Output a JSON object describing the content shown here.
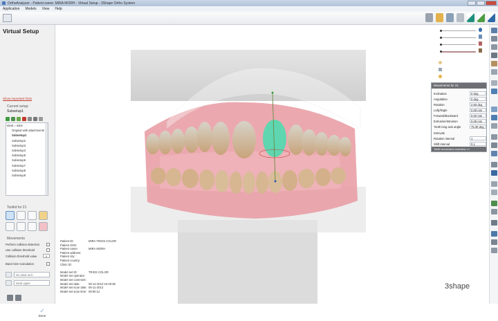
{
  "window": {
    "title": "OrthoAnalyzer - Patient name: MIRA MORH - Virtual Setup - 3Shape Ortho System"
  },
  "menu": [
    "Application",
    "Models",
    "View",
    "Help"
  ],
  "sidebar": {
    "title": "Virtual Setup",
    "important_link": "Show important hints",
    "current_setup_label": "Current setup:",
    "current_setup_value": "Subsetup1",
    "tree": [
      {
        "label": "Ideal = subs",
        "level": "root"
      },
      {
        "label": "Original with attachments",
        "level": "child"
      },
      {
        "label": "Subsetup1",
        "level": "child",
        "selected": true
      },
      {
        "label": "Subsetup2",
        "level": "child"
      },
      {
        "label": "Subsetup3",
        "level": "child"
      },
      {
        "label": "Subsetup4",
        "level": "child"
      },
      {
        "label": "Subsetup5",
        "level": "child"
      },
      {
        "label": "Subsetup6",
        "level": "child"
      },
      {
        "label": "Subsetup7",
        "level": "child"
      },
      {
        "label": "Subsetup8",
        "level": "child"
      },
      {
        "label": "Subsetup9",
        "level": "child"
      }
    ],
    "toolkit_label": "Toolkit for 21",
    "movements_label": "Movements",
    "movements": {
      "collision_detection": "Perform collision detection",
      "collision_threshold": "Use collision threshold",
      "collision_threshold_value_label": "Collision threshold value",
      "collision_threshold_value": "0",
      "band_size": "Band Size Calculation"
    },
    "dropdown_1": "No ideal arch",
    "dropdown_2": "Ideal upper",
    "done_label": "Done"
  },
  "patient_info": [
    {
      "k": "Patient ID:",
      "v": "MIRA TRIOS COLOR"
    },
    {
      "k": "Patient SSN:",
      "v": ""
    },
    {
      "k": "Patient name:",
      "v": "MIRA MORH"
    },
    {
      "k": "Patient address:",
      "v": ""
    },
    {
      "k": "Patient city:",
      "v": ""
    },
    {
      "k": "Patient country:",
      "v": ""
    },
    {
      "k": "Clinic ID:",
      "v": ""
    },
    {
      "k": "",
      "v": ""
    },
    {
      "k": "Model set ID:",
      "v": "TRIOS COLOR"
    },
    {
      "k": "Model set operator:",
      "v": ""
    },
    {
      "k": "Model set comment:",
      "v": ""
    },
    {
      "k": "Model set date:",
      "v": "06-12-2013 10:20:05"
    },
    {
      "k": "Model set scan date:",
      "v": "05-11-2013"
    },
    {
      "k": "Model set scan time:",
      "v": "09:00:12"
    }
  ],
  "brand": "3shape",
  "movements_panel": {
    "title": "Movements for 21",
    "rows": [
      {
        "label": "Inclination",
        "value": "0 deg"
      },
      {
        "label": "Angulation",
        "value": "0 deg"
      },
      {
        "label": "Rotation",
        "value": "2.93 deg"
      },
      {
        "label": "Lully/lingle",
        "value": "0.09 mm"
      },
      {
        "label": "Forward/Backward",
        "value": "0.00 mm"
      },
      {
        "label": "Extrusion/Intrusion",
        "value": "0.09 mm"
      },
      {
        "label": "Tooth long axis angle",
        "value": "75.30 deg"
      }
    ],
    "intervals_label": "Intervals",
    "rotation_interval_label": "Rotation interval",
    "rotation_interval": "1",
    "shift_interval_label": "Shift interval",
    "shift_interval": "0.1",
    "footer": "Teeth movement overview >>"
  },
  "colors": {
    "accent": "#5f8fc4",
    "link": "#c0392b",
    "panel_header": "#6d6f73",
    "selected_tooth": "#5fd6b0"
  }
}
